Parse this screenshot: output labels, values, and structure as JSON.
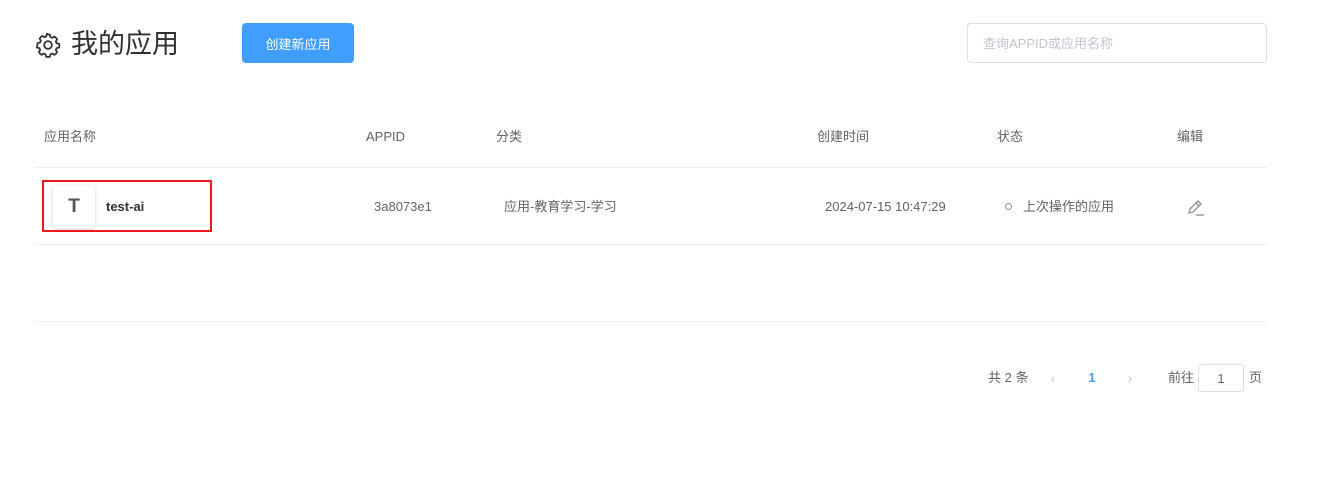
{
  "header": {
    "title": "我的应用",
    "icon": "gear-icon",
    "create_button_label": "创建新应用",
    "search_placeholder": "查询APPID或应用名称",
    "search_value": ""
  },
  "table": {
    "columns": [
      "应用名称",
      "APPID",
      "分类",
      "创建时间",
      "状态",
      "编辑"
    ],
    "rows": [
      {
        "avatar_letter": "T",
        "name": "test-ai",
        "appid": "3a8073e1",
        "category": "应用-教育学习-学习",
        "created_at": "2024-07-15 10:47:29",
        "status": "上次操作的应用",
        "edit_icon": "edit-icon"
      }
    ]
  },
  "pagination": {
    "total_text": "共 2 条",
    "current_page": "1",
    "goto_label": "前往",
    "goto_value": "1",
    "page_suffix": "页",
    "prev_icon": "chevron-left-icon",
    "next_icon": "chevron-right-icon"
  },
  "colors": {
    "primary": "#409eff",
    "highlight_border": "#e8181c"
  }
}
